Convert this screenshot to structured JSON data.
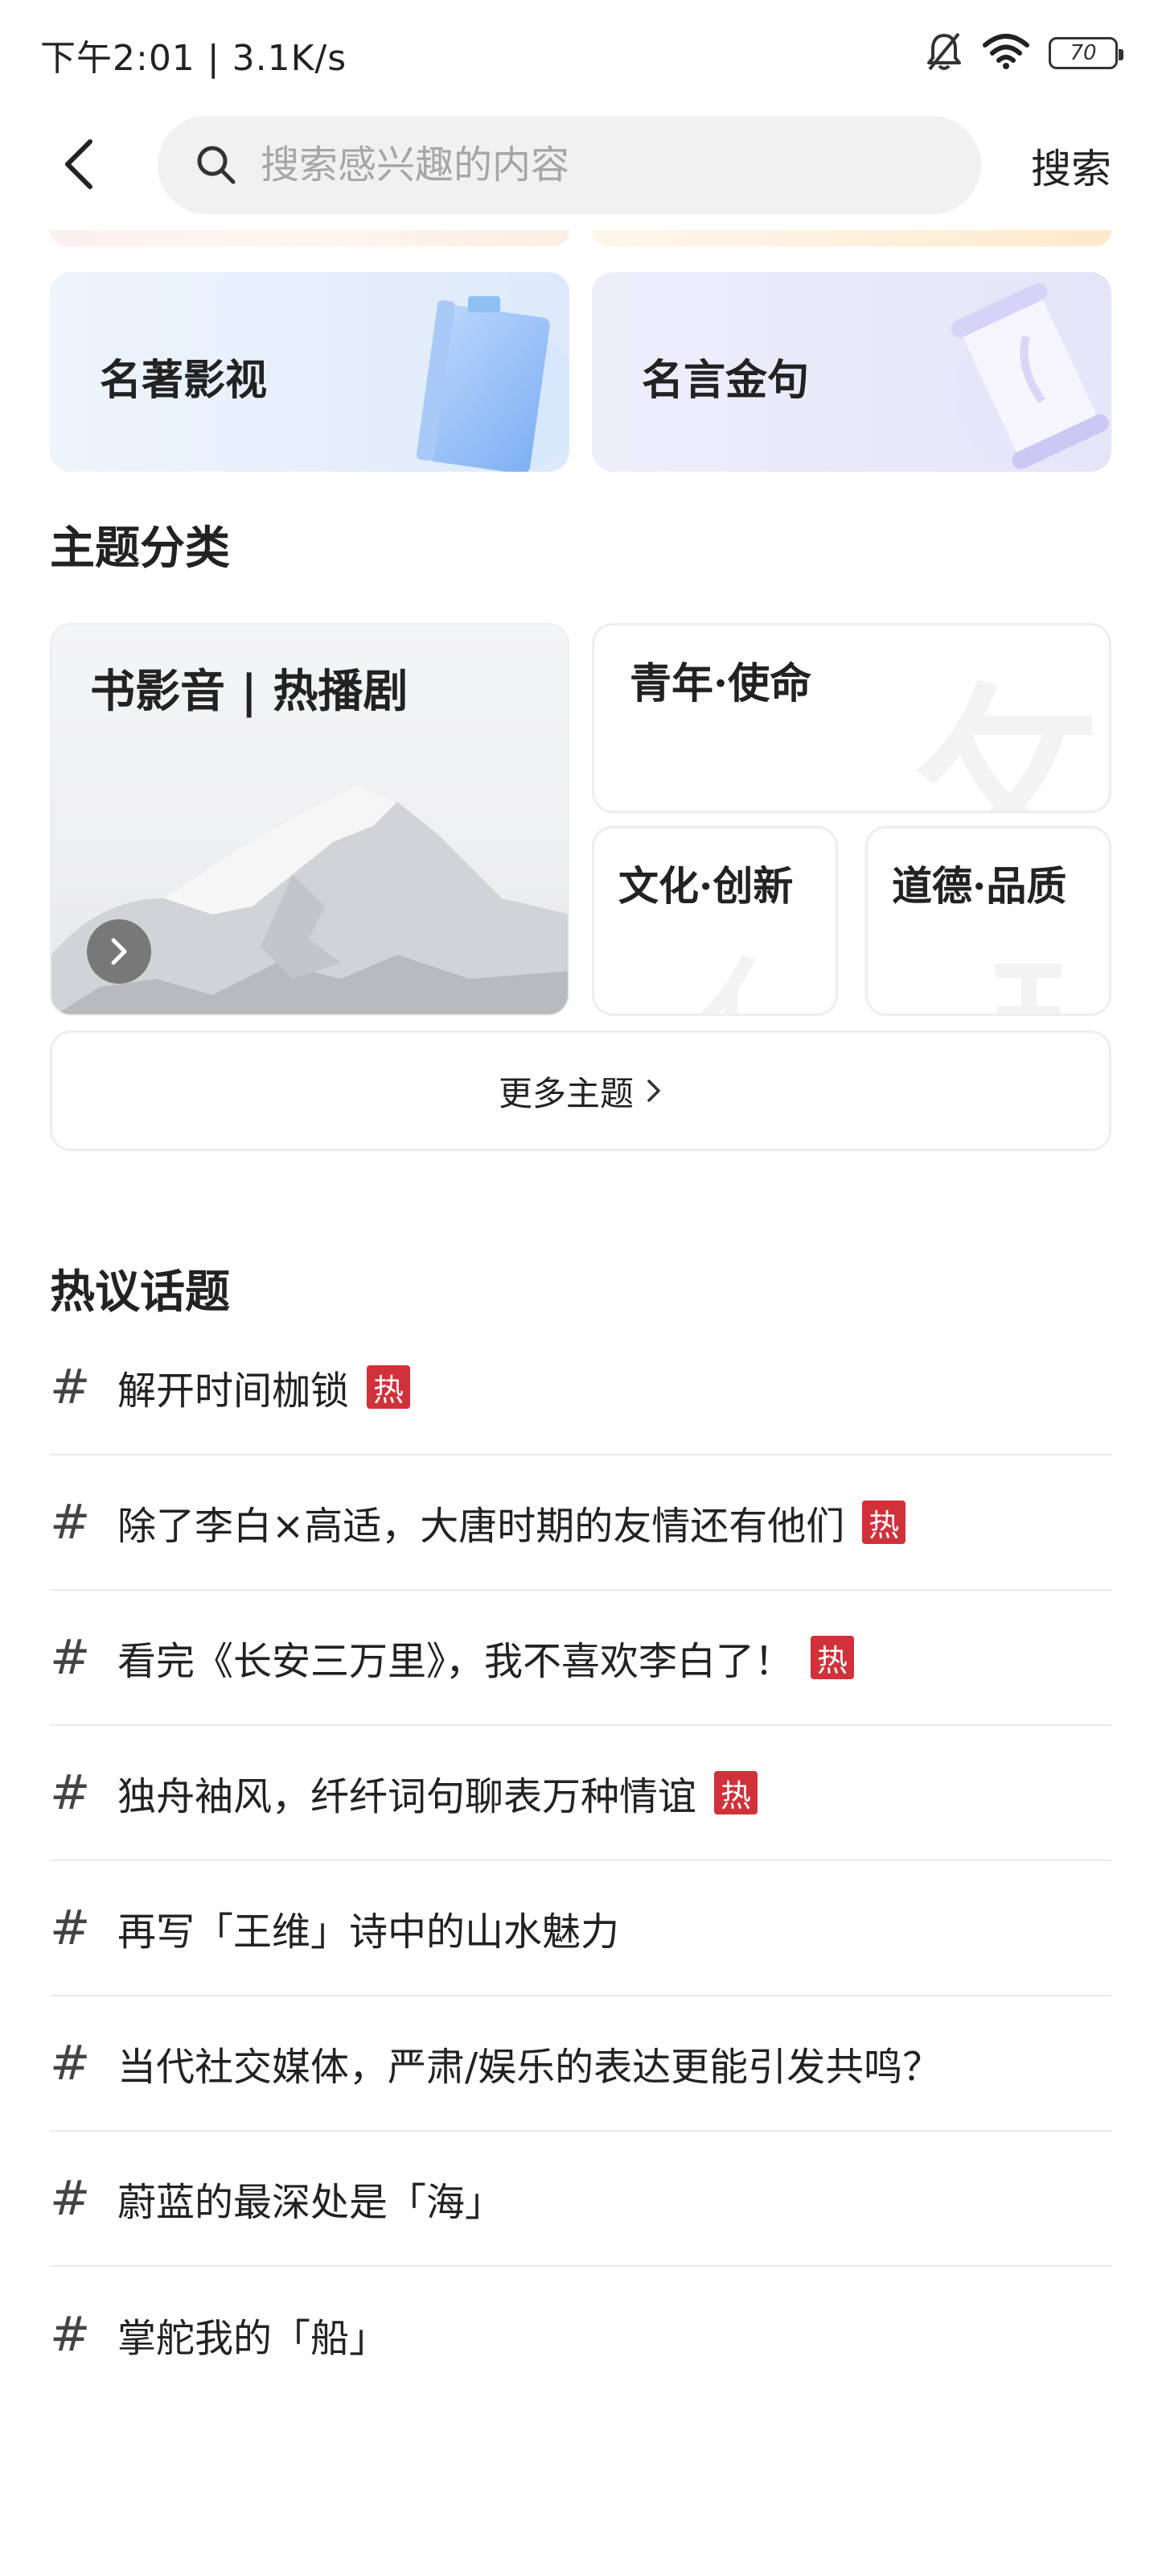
{
  "status_bar": {
    "time_speed": "下午2:01 | 3.1K/s",
    "battery": "70",
    "icons": [
      "bell-off-icon",
      "wifi-icon",
      "battery-icon"
    ]
  },
  "search": {
    "placeholder": "搜索感兴趣的内容",
    "value": "",
    "submit_label": "搜索"
  },
  "categories": [
    {
      "label": "名著影视",
      "icon": "book-illustration"
    },
    {
      "label": "名言金句",
      "icon": "scroll-illustration"
    }
  ],
  "themes": {
    "title": "主题分类",
    "featured": {
      "label": "书影音 | 热播剧"
    },
    "items": [
      {
        "label": "青年·使命"
      },
      {
        "label": "文化·创新"
      },
      {
        "label": "道德·品质"
      }
    ],
    "more_label": "更多主题"
  },
  "topics": {
    "title": "热议话题",
    "hot_label": "热",
    "hash": "#",
    "items": [
      {
        "text": "解开时间枷锁",
        "hot": true
      },
      {
        "text": "除了李白×高适，大唐时期的友情还有他们",
        "hot": true
      },
      {
        "text": "看完《长安三万里》，我不喜欢李白了！",
        "hot": true
      },
      {
        "text": "独舟袖风，纤纤词句聊表万种情谊",
        "hot": true
      },
      {
        "text": "再写「王维」诗中的山水魅力",
        "hot": false
      },
      {
        "text": "当代社交媒体，严肃/娱乐的表达更能引发共鸣？",
        "hot": false
      },
      {
        "text": "蔚蓝的最深处是「海」",
        "hot": false
      },
      {
        "text": "掌舵我的「船」",
        "hot": false
      }
    ]
  },
  "colors": {
    "hot_badge": "#d0313a",
    "search_bg": "#f1f1f1",
    "placeholder": "#a6a6a6"
  }
}
